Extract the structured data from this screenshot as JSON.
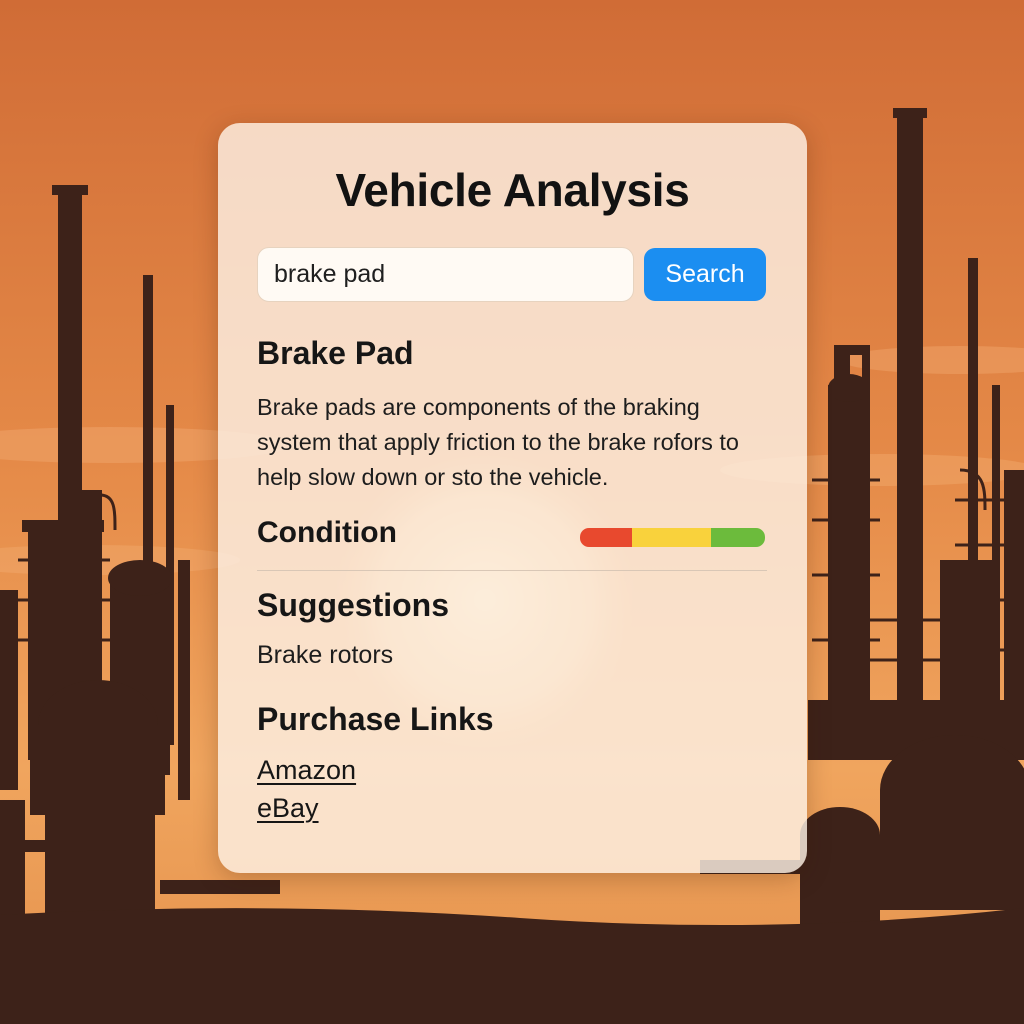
{
  "app": {
    "title": "Vehicle Analysis"
  },
  "search": {
    "value": "brake pad",
    "button_label": "Search"
  },
  "result": {
    "part_name": "Brake Pad",
    "description": "Brake pads are components of the braking system that apply friction to the brake rofors to help slow down or sto the vehicle."
  },
  "condition": {
    "label": "Condition",
    "segments": [
      {
        "color": "#e8492e",
        "fraction": 0.28
      },
      {
        "color": "#f9d23c",
        "fraction": 0.43
      },
      {
        "color": "#6cbb3c",
        "fraction": 0.29
      }
    ]
  },
  "suggestions": {
    "heading": "Suggestions",
    "items": [
      "Brake rotors"
    ]
  },
  "purchase_links": {
    "heading": "Purchase Links",
    "links": [
      "Amazon",
      "eBay"
    ]
  },
  "colors": {
    "accent": "#1b8ef1",
    "sky_top": "#d2713a",
    "sky_bottom": "#f1a861",
    "silhouette": "#3d2219"
  }
}
